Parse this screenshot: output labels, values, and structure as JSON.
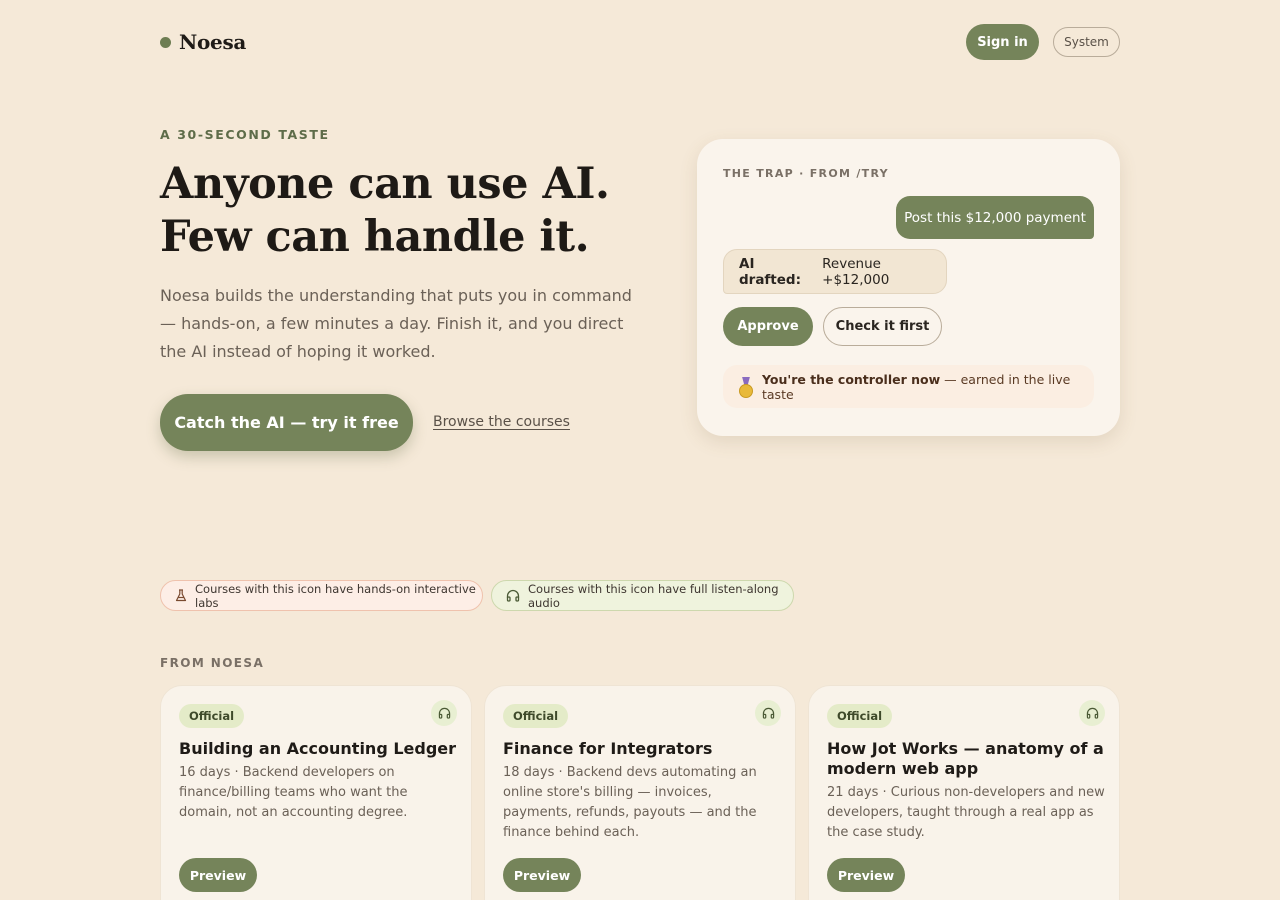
{
  "brand": {
    "name": "Noesa",
    "accent": "#75845a"
  },
  "header": {
    "signin_label": "Sign in",
    "theme_label": "System"
  },
  "hero": {
    "eyebrow": "A 30-SECOND TASTE",
    "title_line1": "Anyone can use AI.",
    "title_line2": "Few can handle it.",
    "description": "Noesa builds the understanding that puts you in command — hands-on, a few minutes a day. Finish it, and you direct the AI instead of hoping it worked.",
    "cta_label": "Catch the AI — try it free",
    "browse_label": "Browse the courses"
  },
  "trap": {
    "label": "THE TRAP · FROM /TRY",
    "user_message": "Post this $12,000 payment",
    "ai_prefix": "AI drafted:",
    "ai_text": "Revenue +$12,000",
    "approve_label": "Approve",
    "check_label": "Check it first",
    "earned_strong": "You're the controller now",
    "earned_rest": "— earned in the live taste",
    "icon": "medal-icon"
  },
  "legend": {
    "labs_text": "Courses with this icon have hands-on interactive labs",
    "labs_icon": "flask-icon",
    "audio_text": "Courses with this icon have full listen-along audio",
    "audio_icon": "headphones-icon"
  },
  "section": {
    "label": "FROM NOESA"
  },
  "courses": [
    {
      "badge": "Official",
      "title": "Building an Accounting Ledger",
      "description": "16 days · Backend developers on finance/billing teams who want the domain, not an accounting degree.",
      "preview_label": "Preview"
    },
    {
      "badge": "Official",
      "title": "Finance for Integrators",
      "description": "18 days · Backend devs automating an online store's billing — invoices, payments, refunds, payouts — and the finance behind each.",
      "preview_label": "Preview"
    },
    {
      "badge": "Official",
      "title": "How Jot Works — anatomy of a modern web app",
      "description": "21 days · Curious non-developers and new developers, taught through a real app as the case study.",
      "preview_label": "Preview"
    }
  ]
}
